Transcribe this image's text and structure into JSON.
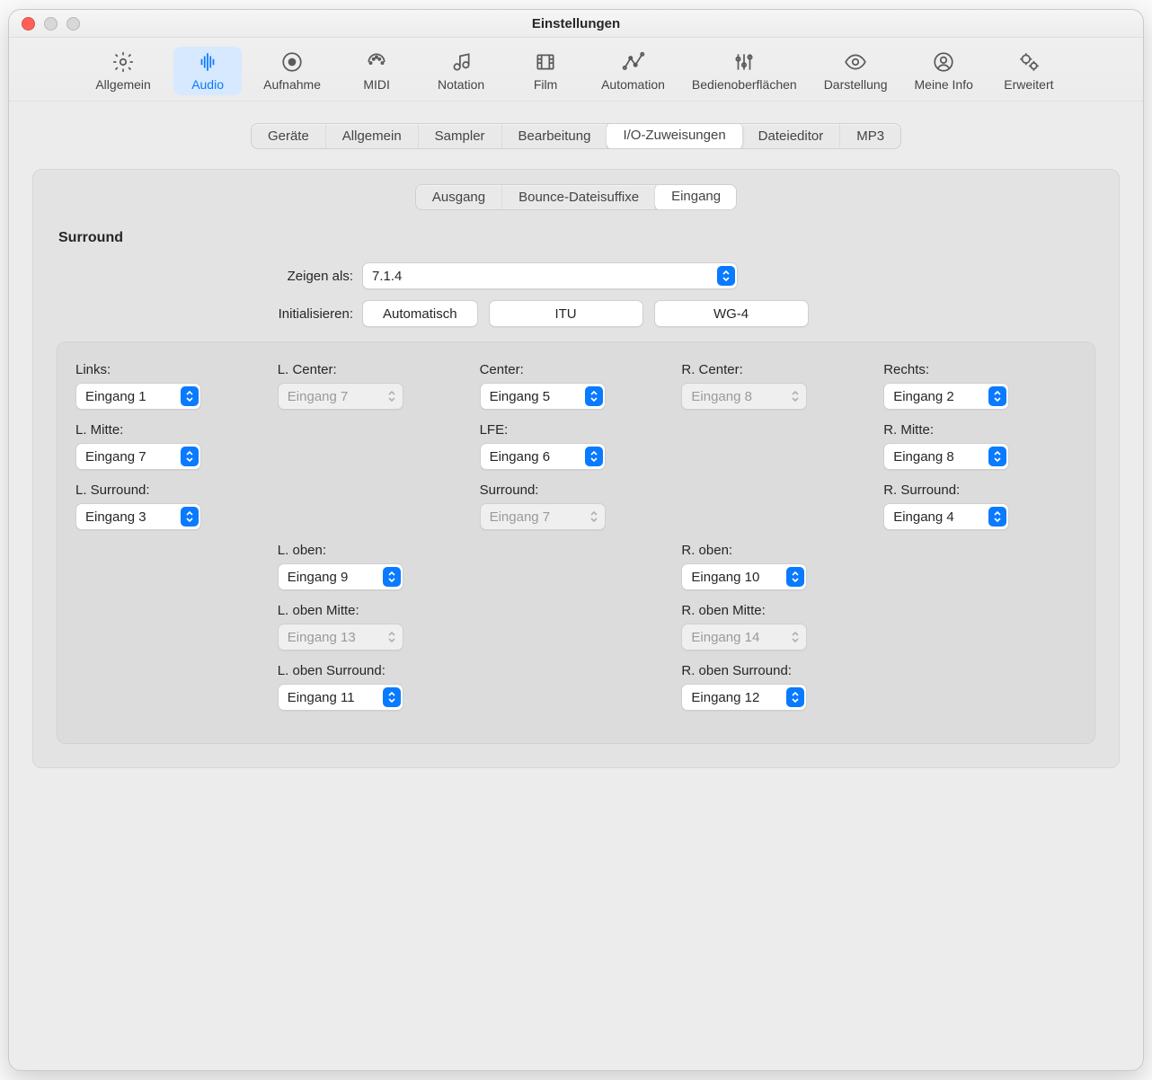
{
  "window": {
    "title": "Einstellungen"
  },
  "toolbar": {
    "items": [
      {
        "id": "allgemein",
        "label": "Allgemein"
      },
      {
        "id": "audio",
        "label": "Audio"
      },
      {
        "id": "aufnahme",
        "label": "Aufnahme"
      },
      {
        "id": "midi",
        "label": "MIDI"
      },
      {
        "id": "notation",
        "label": "Notation"
      },
      {
        "id": "film",
        "label": "Film"
      },
      {
        "id": "automation",
        "label": "Automation"
      },
      {
        "id": "bedien",
        "label": "Bedienoberflächen"
      },
      {
        "id": "darstellung",
        "label": "Darstellung"
      },
      {
        "id": "meineinfo",
        "label": "Meine Info"
      },
      {
        "id": "erweitert",
        "label": "Erweitert"
      }
    ],
    "selected": "audio"
  },
  "tabs1": {
    "items": [
      "Geräte",
      "Allgemein",
      "Sampler",
      "Bearbeitung",
      "I/O-Zuweisungen",
      "Dateieditor",
      "MP3"
    ],
    "selected": "I/O-Zuweisungen"
  },
  "tabs2": {
    "items": [
      "Ausgang",
      "Bounce-Dateisuffixe",
      "Eingang"
    ],
    "selected": "Eingang"
  },
  "section": {
    "title": "Surround"
  },
  "show_as": {
    "label": "Zeigen als:",
    "value": "7.1.4"
  },
  "init": {
    "label": "Initialisieren:",
    "buttons": [
      "Automatisch",
      "ITU",
      "WG-4"
    ]
  },
  "channels": [
    [
      {
        "label": "Links:",
        "value": "Eingang 1",
        "enabled": true
      },
      {
        "label": "L. Center:",
        "value": "Eingang 7",
        "enabled": false
      },
      {
        "label": "Center:",
        "value": "Eingang 5",
        "enabled": true
      },
      {
        "label": "R. Center:",
        "value": "Eingang 8",
        "enabled": false
      },
      {
        "label": "Rechts:",
        "value": "Eingang 2",
        "enabled": true
      }
    ],
    [
      {
        "label": "L. Mitte:",
        "value": "Eingang 7",
        "enabled": true
      },
      null,
      {
        "label": "LFE:",
        "value": "Eingang 6",
        "enabled": true
      },
      null,
      {
        "label": "R. Mitte:",
        "value": "Eingang 8",
        "enabled": true
      }
    ],
    [
      {
        "label": "L. Surround:",
        "value": "Eingang 3",
        "enabled": true
      },
      null,
      {
        "label": "Surround:",
        "value": "Eingang 7",
        "enabled": false
      },
      null,
      {
        "label": "R. Surround:",
        "value": "Eingang 4",
        "enabled": true
      }
    ],
    [
      null,
      {
        "label": "L. oben:",
        "value": "Eingang 9",
        "enabled": true
      },
      null,
      {
        "label": "R. oben:",
        "value": "Eingang 10",
        "enabled": true
      },
      null
    ],
    [
      null,
      {
        "label": "L. oben Mitte:",
        "value": "Eingang 13",
        "enabled": false
      },
      null,
      {
        "label": "R. oben Mitte:",
        "value": "Eingang 14",
        "enabled": false
      },
      null
    ],
    [
      null,
      {
        "label": "L. oben Surround:",
        "value": "Eingang 11",
        "enabled": true
      },
      null,
      {
        "label": "R. oben Surround:",
        "value": "Eingang 12",
        "enabled": true
      },
      null
    ]
  ]
}
